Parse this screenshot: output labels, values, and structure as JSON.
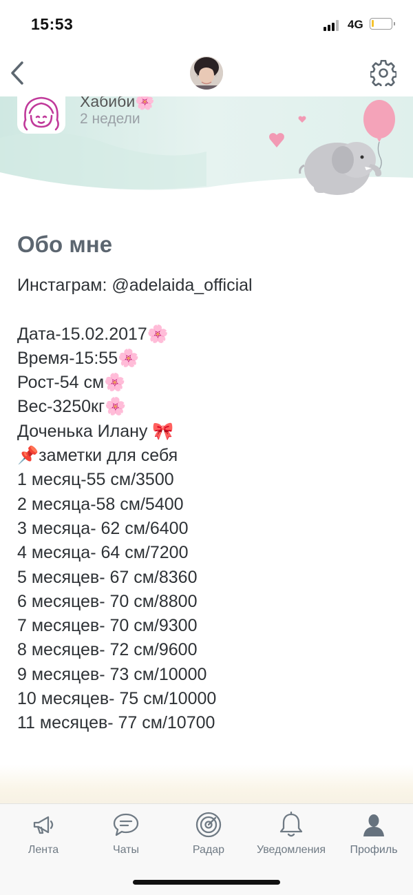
{
  "status_bar": {
    "time": "15:53",
    "network": "4G",
    "battery_level": 0.12
  },
  "header": {
    "back_icon": "chevron-left-icon",
    "settings_icon": "gear-icon"
  },
  "profile": {
    "name": "Хабиби🌸",
    "subtitle": "2 недели"
  },
  "about": {
    "title": "Обо мне",
    "lines": [
      "Инстаграм: @adelaida_official",
      "",
      "Дата-15.02.2017🌸",
      "Время-15:55🌸",
      "Рост-54 см🌸",
      "Вес-3250кг🌸",
      "Доченька Илану 🎀",
      "📌заметки для себя",
      "1 месяц-55 см/3500",
      "2 месяца-58 см/5400",
      "3 месяца- 62 см/6400",
      "4 месяца- 64 см/7200",
      "5 месяцев- 67 см/8360",
      "6 месяцев- 70 см/8800",
      "7 месяцев- 70 см/9300",
      "8 месяцев- 72 см/9600",
      "9 месяцев- 73 см/10000",
      "10 месяцев- 75 см/10000",
      "11 месяцев- 77 см/10700"
    ]
  },
  "tab_bar": {
    "items": [
      {
        "label": "Лента",
        "icon": "megaphone-icon"
      },
      {
        "label": "Чаты",
        "icon": "chat-bubble-icon"
      },
      {
        "label": "Радар",
        "icon": "radar-icon"
      },
      {
        "label": "Уведомления",
        "icon": "bell-icon"
      },
      {
        "label": "Профиль",
        "icon": "person-icon"
      }
    ],
    "active_index": 4
  },
  "colors": {
    "title": "#5c6670",
    "text": "#2e3236",
    "tab_label": "#6f7a84",
    "banner_tint": "#d9ede8",
    "balloon": "#f49fb6"
  }
}
